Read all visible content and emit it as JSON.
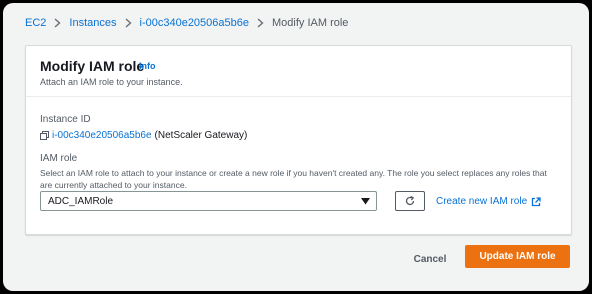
{
  "breadcrumb": {
    "items": [
      {
        "label": "EC2"
      },
      {
        "label": "Instances"
      },
      {
        "label": "i-00c340e20506a5b6e"
      },
      {
        "label": "Modify IAM role"
      }
    ]
  },
  "panel": {
    "title": "Modify IAM role",
    "info_label": "Info",
    "description": "Attach an IAM role to your instance."
  },
  "instance": {
    "label": "Instance ID",
    "id": "i-00c340e20506a5b6e",
    "name": "(NetScaler Gateway)"
  },
  "iam_role": {
    "label": "IAM role",
    "description": "Select an IAM role to attach to your instance or create a new role if you haven't created any. The role you select replaces any roles that are currently attached to your instance.",
    "selected": "ADC_IAMRole",
    "create_link": "Create new IAM role"
  },
  "actions": {
    "cancel": "Cancel",
    "submit": "Update IAM role"
  },
  "colors": {
    "link": "#0972d3",
    "primary": "#ec7211",
    "background": "#f2f3f3"
  },
  "icons": [
    "chevron-right-icon",
    "copy-icon",
    "caret-down-icon",
    "refresh-icon",
    "external-link-icon"
  ]
}
